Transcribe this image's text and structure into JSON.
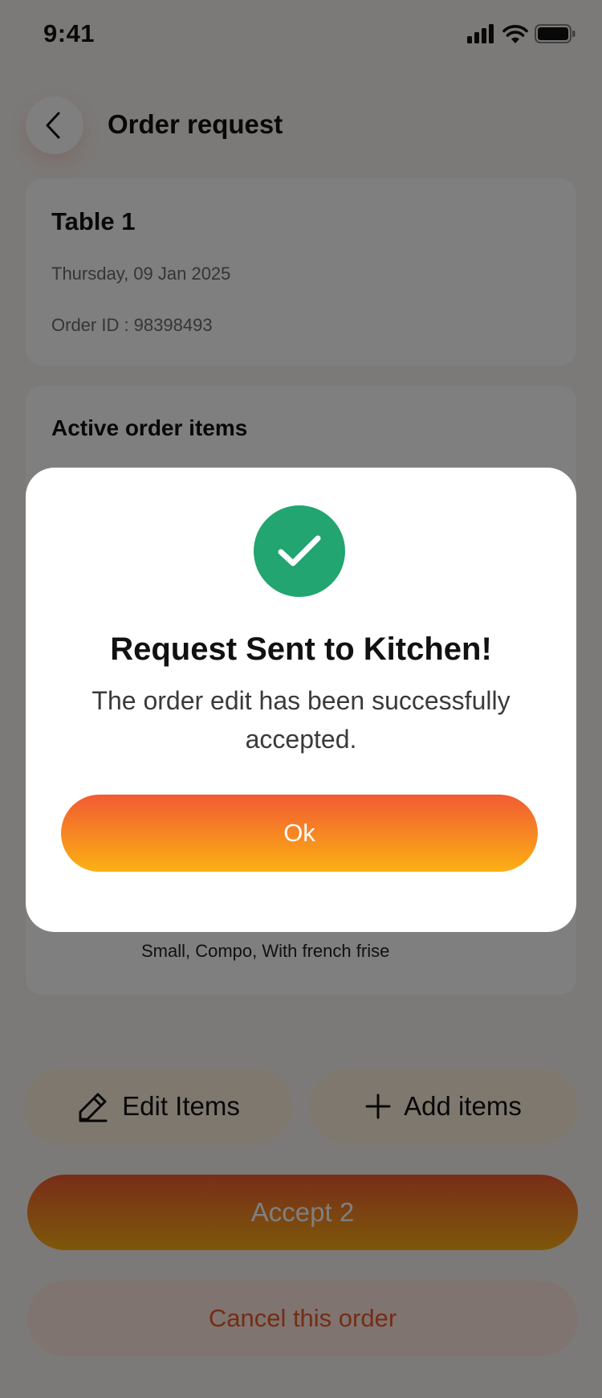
{
  "status_bar": {
    "time": "9:41",
    "icons": [
      "cellular-signal-icon",
      "wifi-icon",
      "battery-icon"
    ]
  },
  "header": {
    "back_icon": "chevron-left-icon",
    "title": "Order request"
  },
  "order_info": {
    "table_name": "Table 1",
    "date": "Thursday, 09 Jan 2025",
    "order_id": "Order ID : 98398493"
  },
  "active_items": {
    "title": "Active order items",
    "visible_item_options": "Small, Compo, With french frise"
  },
  "actions": {
    "edit_label": "Edit Items",
    "edit_icon": "pencil-icon",
    "add_label": "Add items",
    "add_icon": "plus-icon",
    "accept_label": "Accept 2",
    "cancel_label": "Cancel this order"
  },
  "modal": {
    "icon": "checkmark-icon",
    "title": "Request Sent to Kitchen!",
    "message": "The order edit has been successfully accepted.",
    "ok_label": "Ok"
  },
  "colors": {
    "accent_gradient_start": "#f15b32",
    "accent_gradient_end": "#fcb014",
    "success": "#22a570",
    "secondary_pill": "#fff1dc",
    "cancel_pill": "#ffe8e1",
    "cancel_text": "#e85a2a",
    "overlay": "rgba(0,0,0,0.5)"
  }
}
